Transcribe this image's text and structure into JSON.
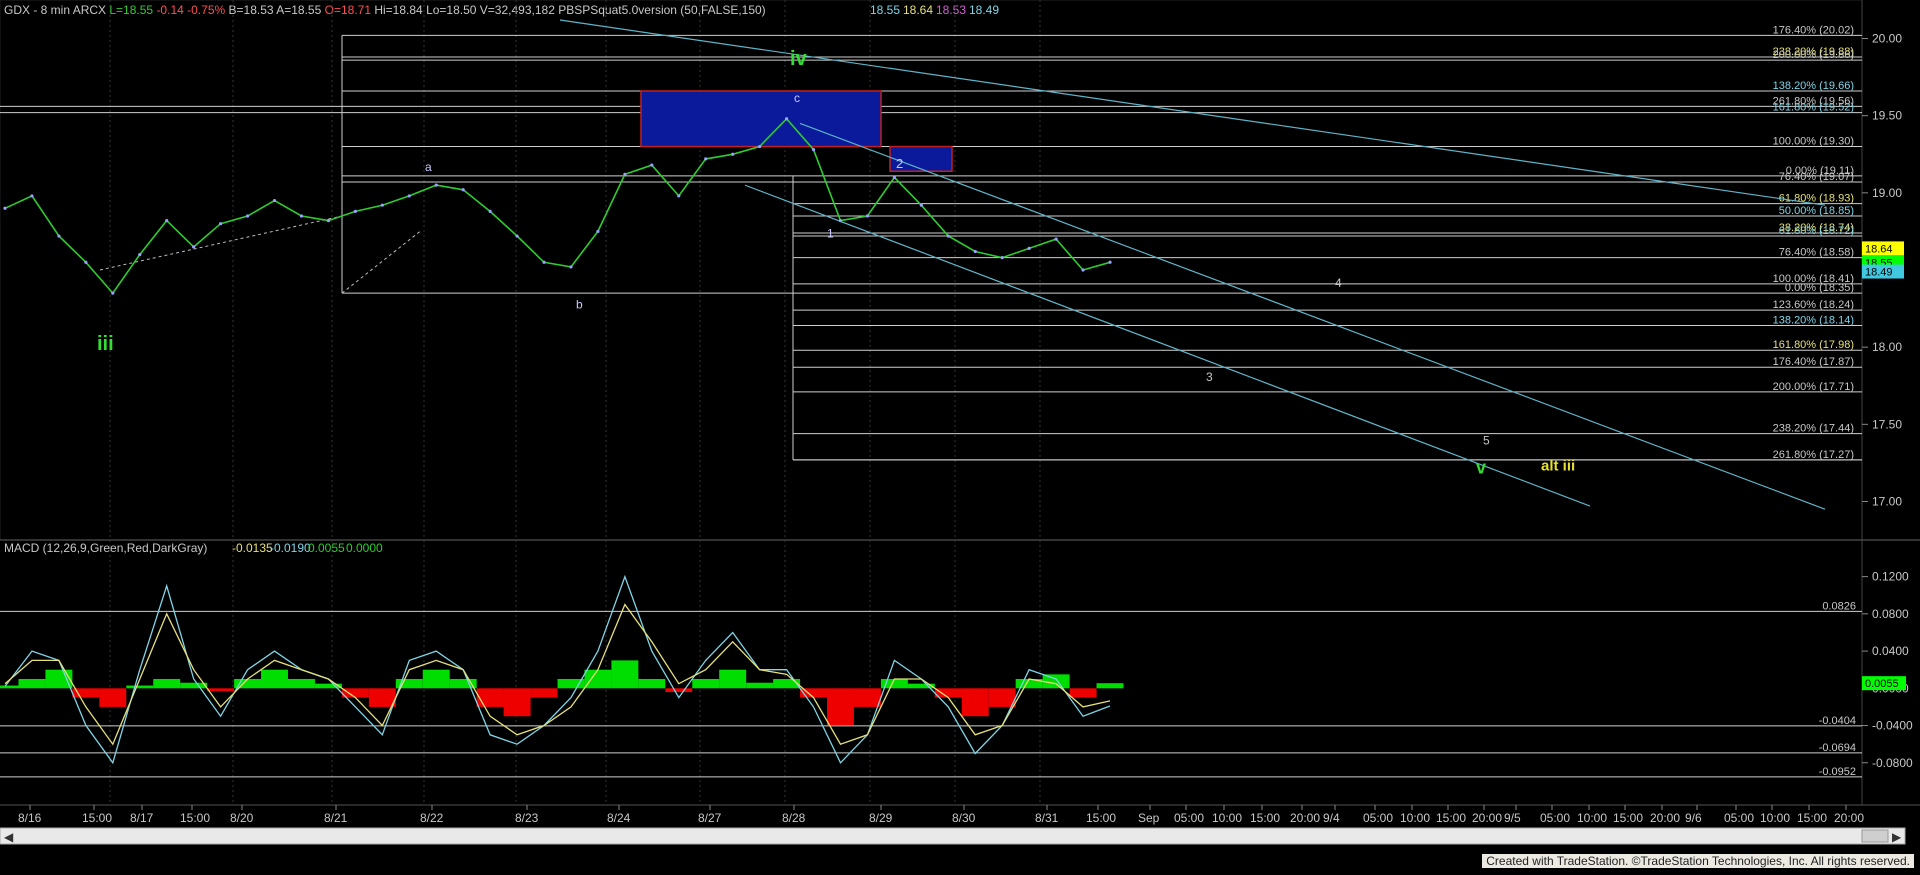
{
  "header": {
    "symbol": "GDX - 8 min",
    "exchange": "ARCX",
    "last": "L=18.55",
    "change": "-0.14",
    "change_pct": "-0.75%",
    "bid": "B=18.53",
    "ask": "A=18.55",
    "open": "O=18.71",
    "high": "Hi=18.84",
    "low": "Lo=18.50",
    "volume": "V=32,493,182",
    "indicator": "PBSPSquat5.0version (50,FALSE,150)",
    "ind_values": [
      "18.55",
      "18.64",
      "18.53",
      "18.49"
    ],
    "ind_colors": [
      "#7fd4e6",
      "#e6e07a",
      "#d060d0",
      "#7fd4e6"
    ]
  },
  "macd_header": {
    "label": "MACD (12,26,9,Green,Red,DarkGray)",
    "values": [
      "-0.0135",
      "-0.0190",
      "0.0055",
      "0.0000"
    ],
    "colors": [
      "#e6e07a",
      "#7fd4e6",
      "#2ecc2e",
      "#2ecc2e"
    ]
  },
  "x_axis": {
    "labels": [
      "8/16",
      "15:00",
      "8/17",
      "15:00",
      "8/20",
      "8/21",
      "8/22",
      "8/23",
      "8/24",
      "8/27",
      "8/28",
      "8/29",
      "8/30",
      "8/31",
      "15:00",
      "Sep",
      "05:00",
      "10:00",
      "15:00",
      "20:00",
      "9/4",
      "05:00",
      "10:00",
      "15:00",
      "20:00",
      "9/5",
      "05:00",
      "10:00",
      "15:00",
      "20:00",
      "9/6",
      "05:00",
      "10:00",
      "15:00",
      "20:00"
    ]
  },
  "price_axis": {
    "ticks": [
      "20.00",
      "19.50",
      "19.00",
      "18.50",
      "18.00",
      "17.50",
      "17.00"
    ],
    "badges": [
      {
        "text": "18.64",
        "bg": "#ffff00",
        "fg": "#000000"
      },
      {
        "text": "18.55",
        "bg": "#00ff00",
        "fg": "#000000"
      },
      {
        "text": "18.49",
        "bg": "#40c8e0",
        "fg": "#000000"
      }
    ]
  },
  "macd_axis": {
    "ticks": [
      "0.1200",
      "0.0800",
      "0.0400",
      "0.0000",
      "-0.0400",
      "-0.0800"
    ],
    "badge": {
      "text": "0.0055",
      "bg": "#00ff00",
      "fg": "#000000"
    }
  },
  "fib_upper": [
    {
      "label": "176.40% (20.02)",
      "color": "#c8c8c8"
    },
    {
      "label": "238.20% (19.88)",
      "color": "#e6e07a"
    },
    {
      "label": "200.00% (19.86)",
      "color": "#c8c8c8"
    },
    {
      "label": "138.20% (19.66)",
      "color": "#7fd4e6"
    },
    {
      "label": "261.80% (19.56)",
      "color": "#c8c8c8"
    },
    {
      "label": "161.80% (19.52)",
      "color": "#7fd4e6"
    },
    {
      "label": "100.00% (19.30)",
      "color": "#c8c8c8"
    },
    {
      "label": "0.00% (19.11)",
      "color": "#c8c8c8"
    },
    {
      "label": "76.40% (19.07)",
      "color": "#c8c8c8"
    },
    {
      "label": "61.80% (18.93)",
      "color": "#e6e07a"
    },
    {
      "label": "50.00% (18.85)",
      "color": "#7fd4e6"
    },
    {
      "label": "38.20% (18.74)",
      "color": "#e6e07a"
    },
    {
      "label": "61.80% (18.72)",
      "color": "#7fd4e6"
    },
    {
      "label": "76.40% (18.58)",
      "color": "#c8c8c8"
    },
    {
      "label": "100.00% (18.41)",
      "color": "#c8c8c8"
    },
    {
      "label": "0.00% (18.35)",
      "color": "#c8c8c8"
    },
    {
      "label": "123.60% (18.24)",
      "color": "#c8c8c8"
    },
    {
      "label": "138.20% (18.14)",
      "color": "#7fd4e6"
    },
    {
      "label": "161.80% (17.98)",
      "color": "#e6e07a"
    },
    {
      "label": "176.40% (17.87)",
      "color": "#c8c8c8"
    },
    {
      "label": "200.00% (17.71)",
      "color": "#c8c8c8"
    },
    {
      "label": "238.20% (17.44)",
      "color": "#c8c8c8"
    },
    {
      "label": "261.80% (17.27)",
      "color": "#c8c8c8"
    }
  ],
  "wave_labels": {
    "iii": "iii",
    "iv": "iv",
    "v": "v",
    "alt_iii": "alt iii",
    "a": "a",
    "b": "b",
    "c": "c",
    "w1": "1",
    "w2": "2",
    "w3": "3",
    "w4": "4",
    "w5": "5"
  },
  "macd_levels": [
    "0.0826",
    "-0.0404",
    "-0.0694",
    "-0.0952"
  ],
  "colors": {
    "price": "#2ecc2e",
    "signal": "#e6e07a",
    "macd_line": "#7fd4e6",
    "hist_pos": "#00dd00",
    "hist_neg": "#ee0000",
    "channel": "#5fb3c8",
    "box_blue": "#0a1a9a",
    "box_red": "#c02020"
  },
  "footer": "Created with TradeStation. ©TradeStation Technologies, Inc. All rights reserved.",
  "chart_data": {
    "type": "line",
    "title": "GDX - 8 min",
    "ylim": [
      16.88,
      20.12
    ],
    "series": [
      {
        "name": "GDX",
        "x": [
          "8/16",
          "8/16",
          "8/16",
          "8/16",
          "8/17",
          "8/17",
          "8/17",
          "8/17",
          "8/17",
          "8/20",
          "8/20",
          "8/20",
          "8/21",
          "8/21",
          "8/21",
          "8/22",
          "8/22",
          "8/22",
          "8/23",
          "8/23",
          "8/23",
          "8/23",
          "8/24",
          "8/24",
          "8/24",
          "8/27",
          "8/27",
          "8/27",
          "8/28",
          "8/28",
          "8/28",
          "8/28",
          "8/29",
          "8/29",
          "8/29",
          "8/30",
          "8/30",
          "8/30",
          "8/31",
          "8/31",
          "8/31",
          "8/31"
        ],
        "values": [
          18.9,
          18.98,
          18.72,
          18.55,
          18.35,
          18.6,
          18.82,
          18.65,
          18.8,
          18.85,
          18.95,
          18.85,
          18.82,
          18.88,
          18.92,
          18.98,
          19.05,
          19.02,
          18.88,
          18.72,
          18.55,
          18.52,
          18.75,
          19.12,
          19.18,
          18.98,
          19.22,
          19.25,
          19.3,
          19.48,
          19.28,
          18.82,
          18.85,
          19.1,
          18.92,
          18.72,
          18.62,
          18.58,
          18.64,
          18.7,
          18.5,
          18.55
        ]
      }
    ],
    "macd": {
      "name": "MACD (12,26,9,Green,Red,DarkGray)",
      "ylim": [
        -0.12,
        0.14
      ],
      "histogram": [
        0.003,
        0.01,
        0.02,
        -0.01,
        -0.02,
        0.003,
        0.01,
        0.006,
        -0.003,
        0.01,
        0.02,
        0.01,
        0.005,
        -0.01,
        -0.02,
        0.01,
        0.02,
        0.01,
        -0.02,
        -0.03,
        -0.01,
        0.01,
        0.02,
        0.03,
        0.01,
        -0.004,
        0.01,
        0.02,
        0.006,
        0.01,
        -0.01,
        -0.04,
        -0.02,
        0.01,
        0.005,
        -0.01,
        -0.03,
        -0.02,
        0.01,
        0.015,
        -0.01,
        0.0055
      ],
      "macd_line": [
        0.002,
        0.04,
        0.03,
        -0.04,
        -0.08,
        0.02,
        0.11,
        0.01,
        -0.03,
        0.02,
        0.04,
        0.02,
        0.01,
        -0.02,
        -0.05,
        0.03,
        0.04,
        0.02,
        -0.05,
        -0.06,
        -0.04,
        -0.01,
        0.04,
        0.12,
        0.04,
        -0.01,
        0.03,
        0.06,
        0.02,
        0.02,
        -0.02,
        -0.08,
        -0.05,
        0.03,
        0.01,
        -0.02,
        -0.07,
        -0.04,
        0.02,
        0.01,
        -0.03,
        -0.019
      ],
      "signal": [
        0.005,
        0.03,
        0.03,
        -0.02,
        -0.06,
        0.01,
        0.08,
        0.02,
        -0.02,
        0.01,
        0.03,
        0.02,
        0.01,
        -0.01,
        -0.04,
        0.02,
        0.03,
        0.02,
        -0.03,
        -0.05,
        -0.04,
        -0.02,
        0.02,
        0.09,
        0.05,
        0.005,
        0.02,
        0.05,
        0.02,
        0.015,
        -0.01,
        -0.06,
        -0.05,
        0.01,
        0.01,
        -0.01,
        -0.05,
        -0.04,
        0.01,
        0.005,
        -0.02,
        -0.0135
      ]
    }
  }
}
